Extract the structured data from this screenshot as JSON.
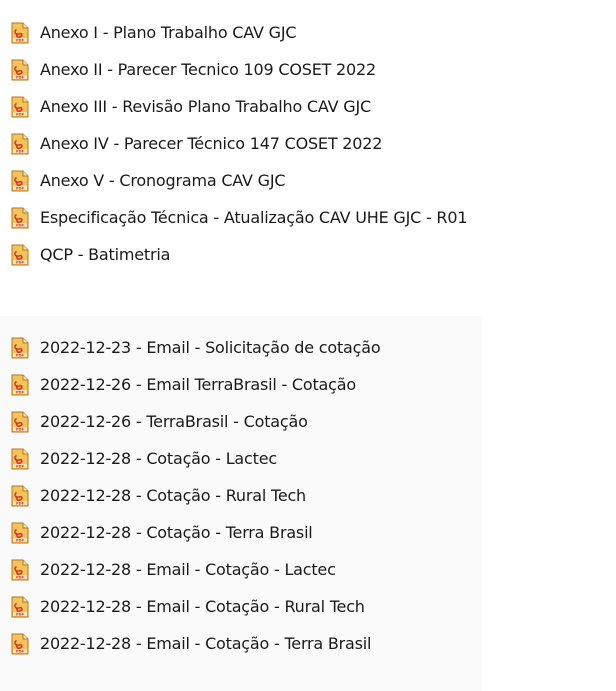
{
  "file_groups": [
    {
      "items": [
        {
          "label": "Anexo I - Plano Trabalho CAV GJC",
          "icon": "pdf-file-icon"
        },
        {
          "label": "Anexo II - Parecer Tecnico 109 COSET 2022",
          "icon": "pdf-file-icon"
        },
        {
          "label": "Anexo III - Revisão Plano Trabalho CAV GJC",
          "icon": "pdf-file-icon"
        },
        {
          "label": "Anexo IV - Parecer Técnico 147 COSET 2022",
          "icon": "pdf-file-icon"
        },
        {
          "label": "Anexo V - Cronograma CAV GJC",
          "icon": "pdf-file-icon"
        },
        {
          "label": "Especificação Técnica - Atualização CAV UHE GJC - R01",
          "icon": "pdf-file-icon"
        },
        {
          "label": "QCP - Batimetria",
          "icon": "pdf-file-icon"
        }
      ]
    },
    {
      "items": [
        {
          "label": "2022-12-23 - Email - Solicitação de cotação",
          "icon": "pdf-file-icon"
        },
        {
          "label": "2022-12-26 - Email TerraBrasil - Cotação",
          "icon": "pdf-file-icon"
        },
        {
          "label": "2022-12-26 - TerraBrasil - Cotação",
          "icon": "pdf-file-icon"
        },
        {
          "label": "2022-12-28 - Cotação - Lactec",
          "icon": "pdf-file-icon"
        },
        {
          "label": "2022-12-28 - Cotação - Rural Tech",
          "icon": "pdf-file-icon"
        },
        {
          "label": "2022-12-28 - Cotação - Terra Brasil",
          "icon": "pdf-file-icon"
        },
        {
          "label": "2022-12-28 - Email - Cotação - Lactec",
          "icon": "pdf-file-icon"
        },
        {
          "label": "2022-12-28 - Email - Cotação - Rural Tech",
          "icon": "pdf-file-icon"
        },
        {
          "label": "2022-12-28 - Email - Cotação - Terra Brasil",
          "icon": "pdf-file-icon"
        }
      ]
    }
  ],
  "colors": {
    "icon_body": "#f6c25a",
    "icon_border": "#b07a1c",
    "icon_accent": "#d23b2c"
  }
}
